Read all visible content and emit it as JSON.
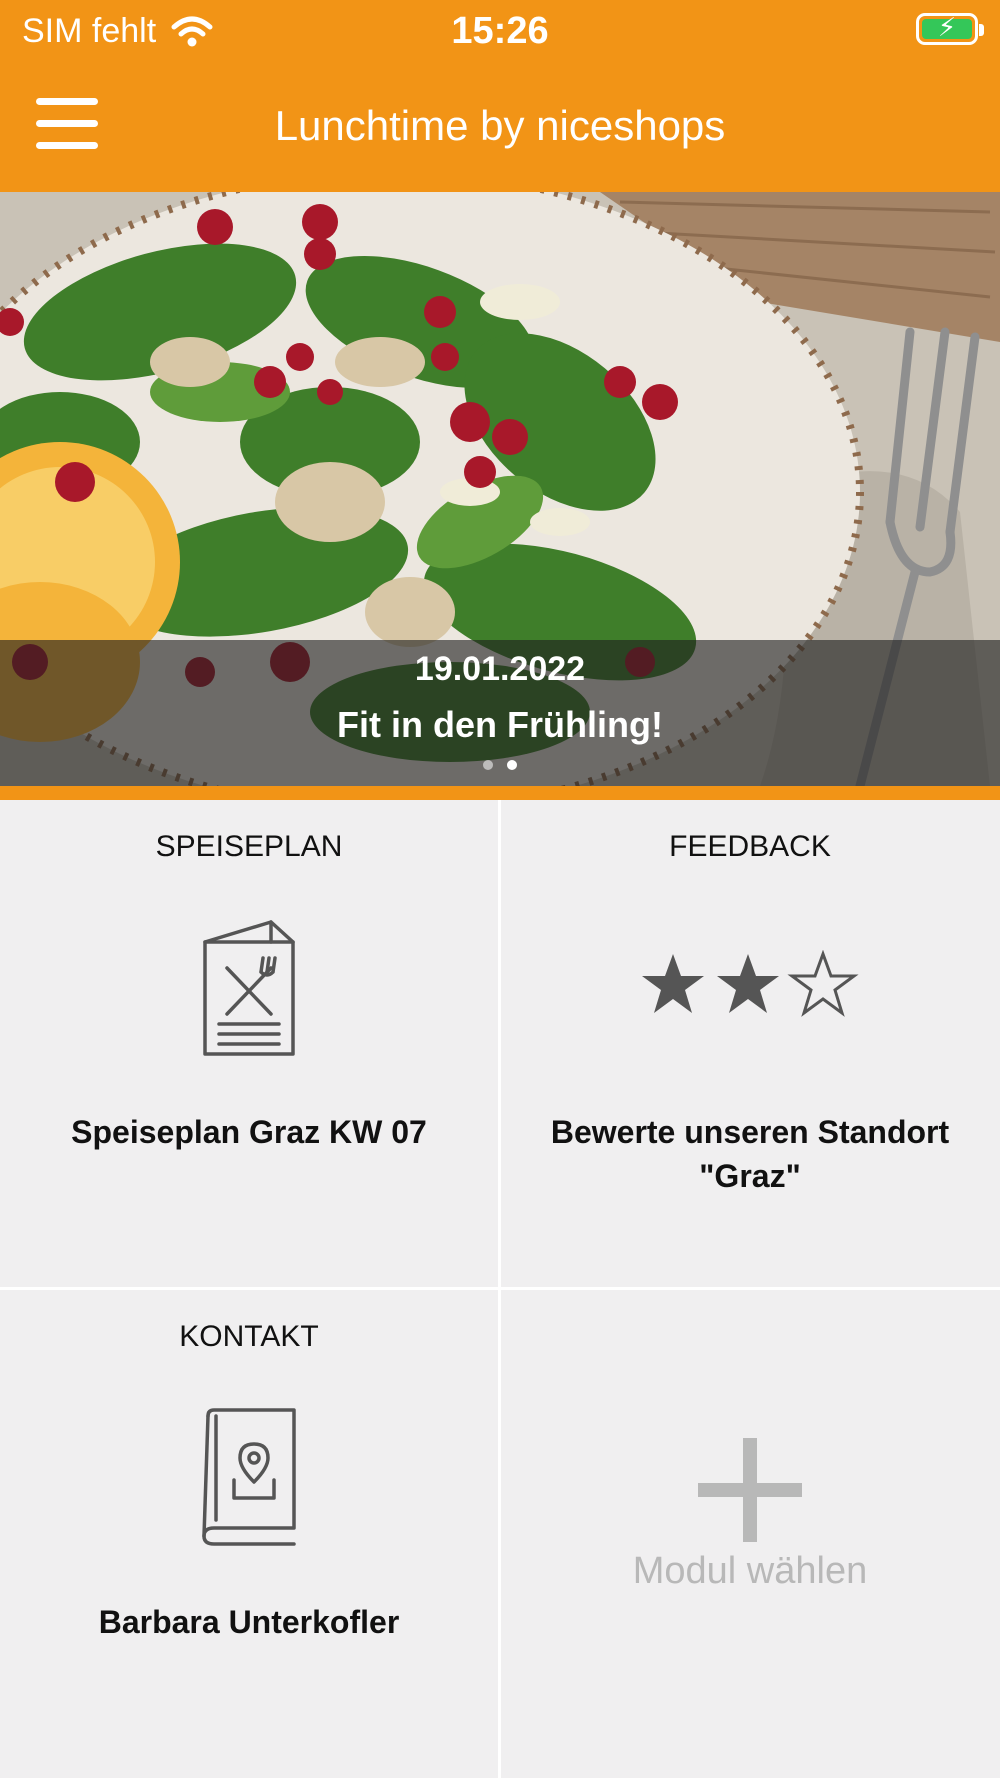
{
  "status_bar": {
    "carrier": "SIM fehlt",
    "time": "15:26"
  },
  "nav": {
    "title": "Lunchtime by niceshops",
    "menu_icon": "hamburger-menu-icon"
  },
  "banner": {
    "date": "19.01.2022",
    "title": "Fit in den Frühling!",
    "slide_count": 2,
    "active_slide": 2
  },
  "tiles": [
    {
      "header": "SPEISEPLAN",
      "icon": "menu-card-icon",
      "footer": "Speiseplan Graz KW 07"
    },
    {
      "header": "FEEDBACK",
      "icon": "star-rating-icon",
      "rating": 2,
      "rating_max": 3,
      "footer": "Bewerte unseren Standort \"Graz\""
    },
    {
      "header": "KONTAKT",
      "icon": "contact-book-icon",
      "footer": "Barbara Unterkofler"
    },
    {
      "header": "",
      "icon": "plus-icon",
      "footer": "Modul wählen"
    }
  ],
  "colors": {
    "accent": "#f29416",
    "tile_background": "#f0eff0",
    "icon_gray": "#555555",
    "placeholder_gray": "#b8b8b8"
  }
}
